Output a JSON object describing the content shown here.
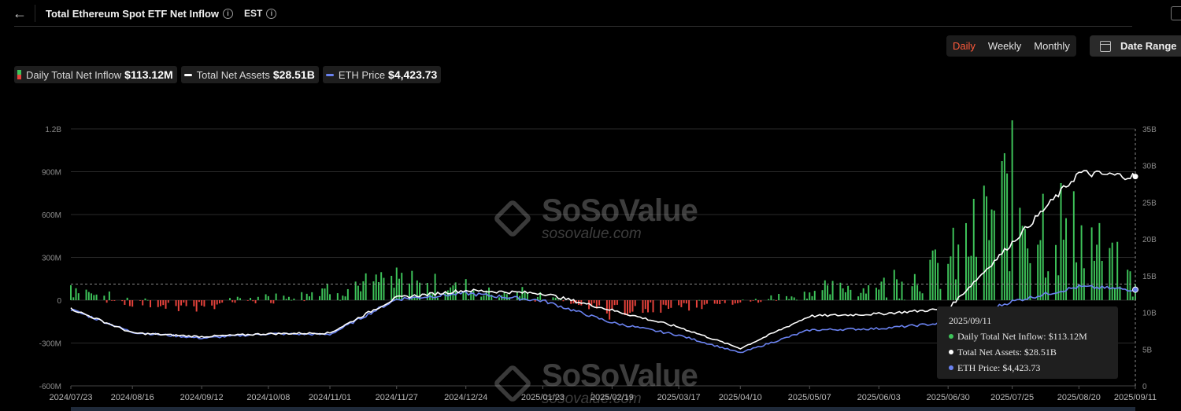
{
  "header": {
    "back_icon": "arrow-left-icon",
    "title": "Total Ethereum Spot ETF Net Inflow",
    "timezone": "EST"
  },
  "periods": {
    "daily": "Daily",
    "weekly": "Weekly",
    "monthly": "Monthly",
    "active": "Daily"
  },
  "date_range_label": "Date Range",
  "legend": {
    "inflow_label": "Daily Total Net Inflow",
    "inflow_value": "$113.12M",
    "assets_label": "Total Net Assets",
    "assets_value": "$28.51B",
    "price_label": "ETH Price",
    "price_value": "$4,423.73"
  },
  "watermark": {
    "brand": "SoSoValue",
    "site": "sosovalue.com"
  },
  "tooltip": {
    "date": "2025/09/11",
    "inflow": "Daily Total Net Inflow: $113.12M",
    "assets": "Total Net Assets: $28.51B",
    "price": "ETH Price: $4,423.73"
  },
  "colors": {
    "positive_bar": "#3ec45a",
    "negative_bar": "#e8433c",
    "assets_line": "#ffffff",
    "price_line": "#6a82f0",
    "active_period": "#ff5a3c"
  },
  "chart_data": {
    "type": "bar",
    "title": "Total Ethereum Spot ETF Net Inflow",
    "x_ticks": [
      "2024/07/23",
      "2024/08/16",
      "2024/09/12",
      "2024/10/08",
      "2024/11/01",
      "2024/11/27",
      "2024/12/24",
      "2025/01/23",
      "2025/02/19",
      "2025/03/17",
      "2025/04/10",
      "2025/05/07",
      "2025/06/03",
      "2025/06/30",
      "2025/07/25",
      "2025/08/20",
      "2025/09/11"
    ],
    "y_left_ticks": [
      "1.2B",
      "900M",
      "600M",
      "300M",
      "0",
      "-300M",
      "-600M"
    ],
    "y_right_ticks": [
      "35B",
      "30B",
      "25B",
      "20B",
      "15B",
      "10B",
      "5B",
      "0"
    ],
    "ylim_left": [
      -600,
      1200
    ],
    "ylim_left_unit": "M",
    "ylim_right": [
      0,
      35
    ],
    "ylim_right_unit": "B",
    "reference_value_inflow": 113.12,
    "grid": true,
    "series": [
      {
        "name": "Daily Total Net Inflow",
        "kind": "bar",
        "x": [
          "2024/07/23",
          "2024/08/16",
          "2024/09/12",
          "2024/10/08",
          "2024/11/01",
          "2024/11/27",
          "2024/12/24",
          "2025/01/23",
          "2025/02/19",
          "2025/03/17",
          "2025/04/10",
          "2025/05/07",
          "2025/06/03",
          "2025/06/30",
          "2025/07/25",
          "2025/08/20",
          "2025/09/11"
        ],
        "values": [
          106,
          -30,
          -40,
          20,
          85,
          130,
          90,
          25,
          -80,
          -40,
          -20,
          60,
          110,
          240,
          720,
          440,
          113.12
        ]
      },
      {
        "name": "Total Net Assets",
        "kind": "line",
        "x": [
          "2024/07/23",
          "2024/08/16",
          "2024/09/12",
          "2024/10/08",
          "2024/11/01",
          "2024/11/27",
          "2024/12/24",
          "2025/01/23",
          "2025/02/19",
          "2025/03/17",
          "2025/04/10",
          "2025/05/07",
          "2025/06/03",
          "2025/06/30",
          "2025/07/25",
          "2025/08/20",
          "2025/09/11"
        ],
        "values": [
          10.5,
          7.2,
          6.7,
          7.1,
          7.2,
          12.0,
          13.0,
          12.6,
          10.3,
          8.0,
          5.1,
          9.5,
          9.8,
          10.5,
          19.5,
          29.0,
          28.51
        ]
      },
      {
        "name": "ETH Price",
        "kind": "line",
        "x": [
          "2024/07/23",
          "2024/08/16",
          "2024/09/12",
          "2024/10/08",
          "2024/11/01",
          "2024/11/27",
          "2024/12/24",
          "2025/01/23",
          "2025/02/19",
          "2025/03/17",
          "2025/04/10",
          "2025/05/07",
          "2025/06/03",
          "2025/06/30",
          "2025/07/25",
          "2025/08/20",
          "2025/09/11"
        ],
        "values": [
          10.4,
          7.3,
          6.5,
          7.1,
          7.0,
          11.8,
          12.6,
          11.6,
          8.6,
          6.9,
          4.5,
          7.6,
          7.8,
          8.6,
          11.5,
          13.5,
          13.1
        ]
      }
    ]
  }
}
